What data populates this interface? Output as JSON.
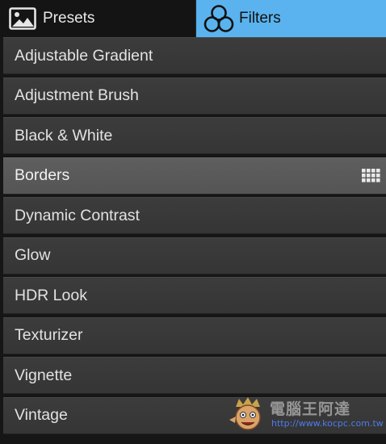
{
  "tabs": {
    "presets": {
      "label": "Presets",
      "icon": "image-icon",
      "active": false
    },
    "filters": {
      "label": "Filters",
      "icon": "circles-icon",
      "active": true
    }
  },
  "filters": {
    "items": [
      {
        "label": "Adjustable Gradient",
        "selected": false
      },
      {
        "label": "Adjustment Brush",
        "selected": false
      },
      {
        "label": "Black & White",
        "selected": false
      },
      {
        "label": "Borders",
        "selected": true,
        "icon": "grid-icon"
      },
      {
        "label": "Dynamic Contrast",
        "selected": false
      },
      {
        "label": "Glow",
        "selected": false
      },
      {
        "label": "HDR Look",
        "selected": false
      },
      {
        "label": "Texturizer",
        "selected": false
      },
      {
        "label": "Vignette",
        "selected": false
      },
      {
        "label": "Vintage",
        "selected": false
      }
    ]
  },
  "watermark": {
    "title": "電腦王阿達",
    "url": "http://www.kocpc.com.tw"
  },
  "colors": {
    "active_tab": "#5ab3ee",
    "item_bg": "#393939",
    "selected_item_bg": "#595959",
    "background": "#161616"
  }
}
